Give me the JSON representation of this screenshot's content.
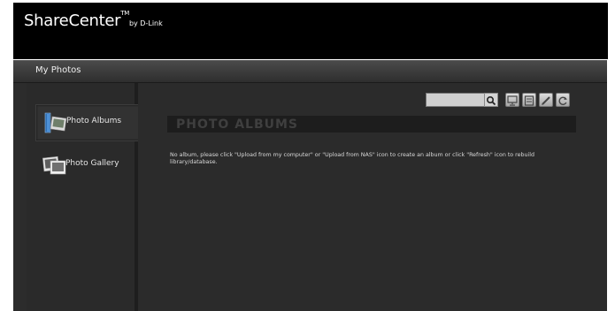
{
  "header": {
    "brand": "ShareCenter",
    "tm": "TM",
    "by": "by D-Link"
  },
  "window": {
    "title": "My Photos"
  },
  "sidebar": {
    "items": [
      {
        "label": "Photo Albums",
        "icon": "photo-albums-icon",
        "active": true
      },
      {
        "label": "Photo Gallery",
        "icon": "photo-gallery-icon",
        "active": false
      }
    ]
  },
  "toolbar": {
    "search_value": "",
    "search_icon": "magnifier-icon",
    "tools": [
      "upload-from-computer-icon",
      "upload-from-nas-icon",
      "edit-icon",
      "refresh-icon"
    ]
  },
  "main": {
    "section_title": "PHOTO ALBUMS",
    "message": "No album, please click \"Upload from my computer\" or \"Upload from NAS\" icon to create an album or click \"Refresh\" icon to rebuild library/database."
  },
  "colors": {
    "header_bg": "#000000",
    "panel_bg": "#2c2c2c",
    "section_bar": "#1d1d1d"
  }
}
